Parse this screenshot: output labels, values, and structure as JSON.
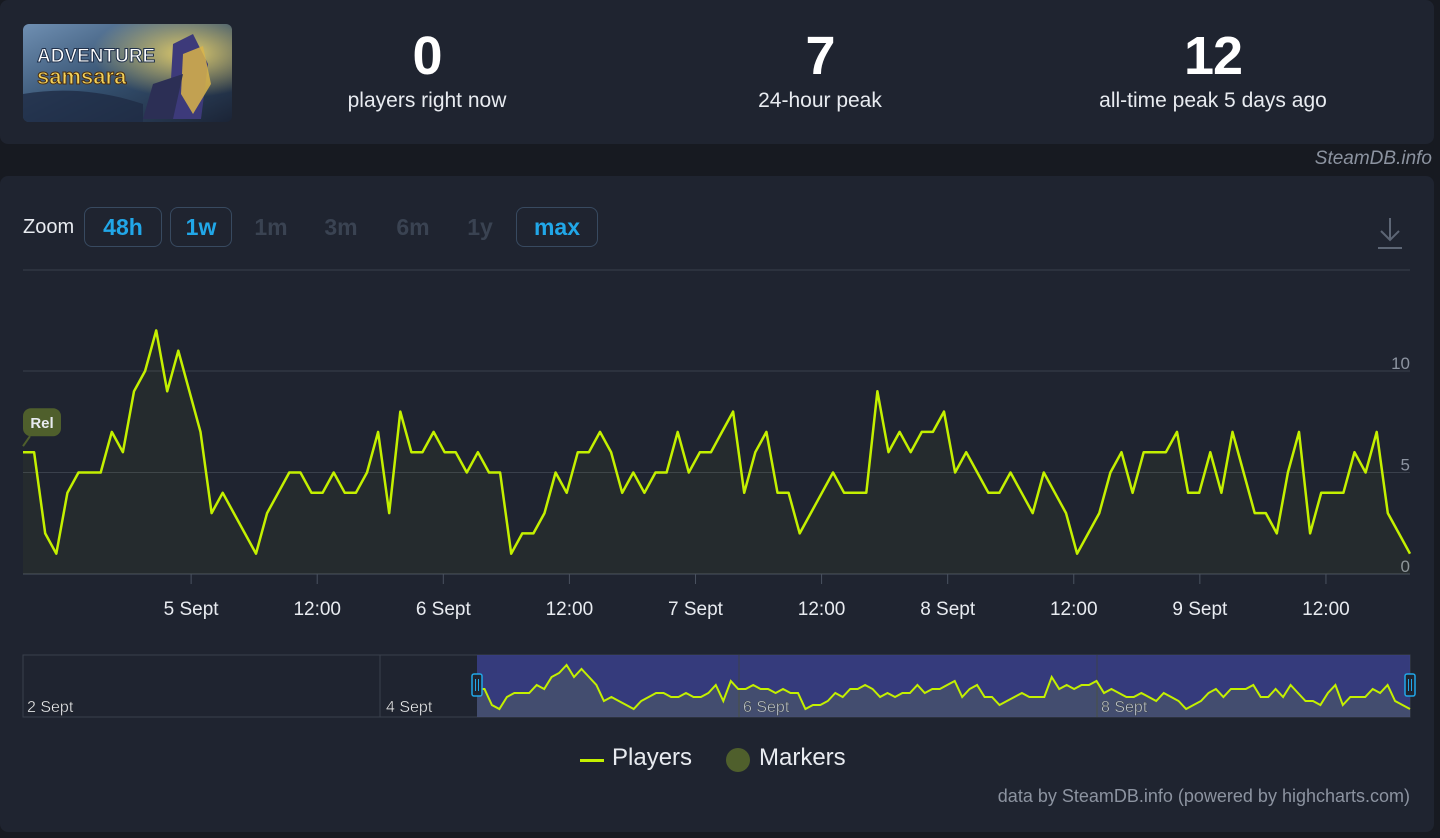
{
  "header": {
    "game_logo_text": "ADVENTURE SAMSARA",
    "stats": [
      {
        "value": "0",
        "label": "players right now"
      },
      {
        "value": "7",
        "label": "24-hour peak"
      },
      {
        "value": "12",
        "label": "all-time peak 5 days ago"
      }
    ],
    "brand": "SteamDB.info"
  },
  "zoom": {
    "label": "Zoom",
    "buttons": [
      {
        "label": "48h",
        "active": true
      },
      {
        "label": "1w",
        "active": true
      },
      {
        "label": "1m",
        "active": false
      },
      {
        "label": "3m",
        "active": false
      },
      {
        "label": "6m",
        "active": false
      },
      {
        "label": "1y",
        "active": false
      },
      {
        "label": "max",
        "active": true
      }
    ],
    "download_icon": "download-icon"
  },
  "colors": {
    "series": "#c4f000",
    "marker": "#4f5f2c",
    "accent": "#21a7e8",
    "navigator_selection": "#3a3f8a"
  },
  "chart_data": {
    "type": "line",
    "series": [
      {
        "name": "Players",
        "values": [
          6,
          6,
          2,
          1,
          4,
          5,
          5,
          5,
          7,
          6,
          9,
          10,
          12,
          9,
          11,
          9,
          7,
          3,
          4,
          3,
          2,
          1,
          3,
          4,
          5,
          5,
          4,
          4,
          5,
          4,
          4,
          5,
          7,
          3,
          8,
          6,
          6,
          7,
          6,
          6,
          5,
          6,
          5,
          5,
          1,
          2,
          2,
          3,
          5,
          4,
          6,
          6,
          7,
          6,
          4,
          5,
          4,
          5,
          5,
          7,
          5,
          6,
          6,
          7,
          8,
          4,
          6,
          7,
          4,
          4,
          2,
          3,
          4,
          5,
          4,
          4,
          4,
          9,
          6,
          7,
          6,
          7,
          7,
          8,
          5,
          6,
          5,
          4,
          4,
          5,
          4,
          3,
          5,
          4,
          3,
          1,
          2,
          3,
          5,
          6,
          4,
          6,
          6,
          6,
          7,
          4,
          4,
          6,
          4,
          7,
          5,
          3,
          3,
          2,
          5,
          7,
          2,
          4,
          4,
          4,
          6,
          5,
          7,
          3,
          2,
          1
        ]
      }
    ],
    "x_start": "2024-09-04 08:00",
    "x_end": "2024-09-09 20:00",
    "xticks": [
      "5 Sept",
      "12:00",
      "6 Sept",
      "12:00",
      "7 Sept",
      "12:00",
      "8 Sept",
      "12:00",
      "9 Sept",
      "12:00"
    ],
    "yticks": [
      "0",
      "5",
      "10"
    ],
    "ylim": [
      0,
      15
    ],
    "grid": true,
    "marker": {
      "label": "Rel",
      "value": 6
    },
    "navigator": {
      "labels": [
        "2 Sept",
        "4 Sept",
        "6 Sept",
        "8 Sept"
      ]
    },
    "legend": [
      {
        "name": "Players",
        "kind": "line"
      },
      {
        "name": "Markers",
        "kind": "dot"
      }
    ]
  },
  "credits": "data by SteamDB.info (powered by highcharts.com)"
}
